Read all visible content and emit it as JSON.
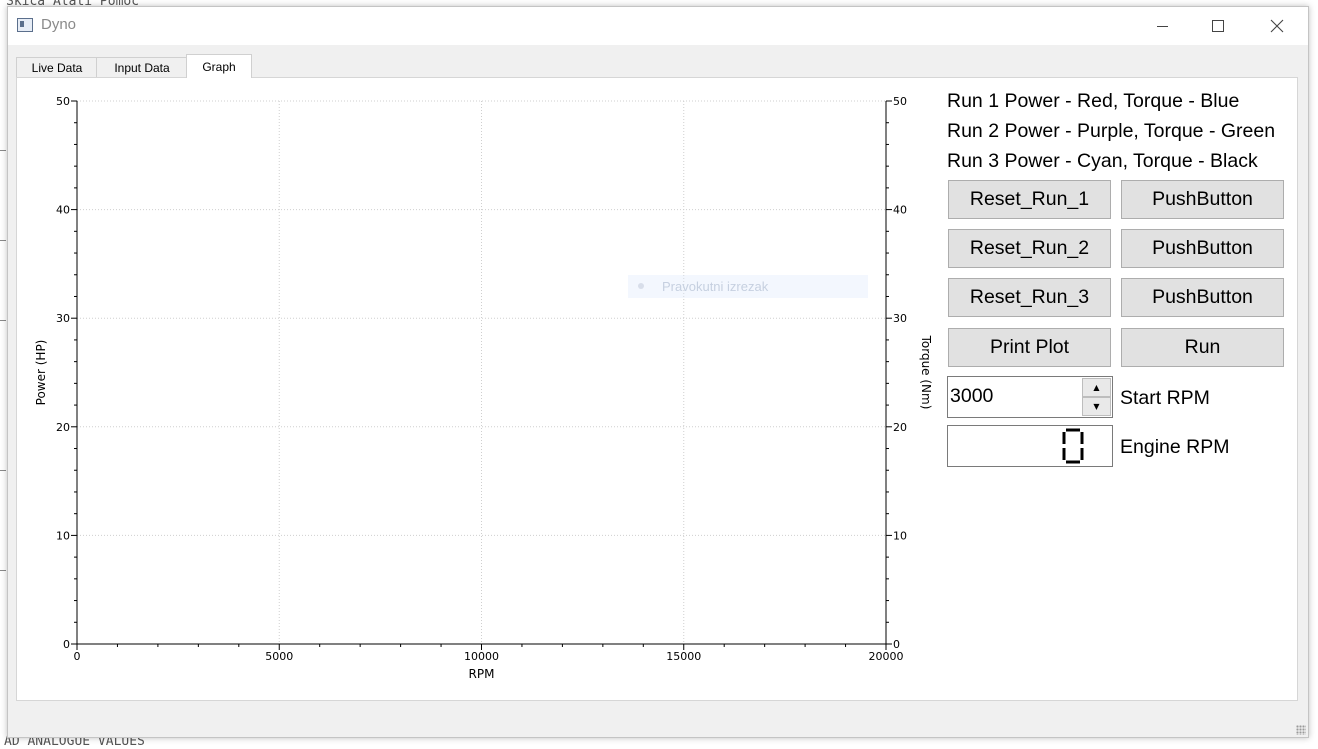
{
  "background": {
    "top_text": "Skica  Alati  Pomoć",
    "bottom_text": "AD ANALOGUE VALUES"
  },
  "window": {
    "title": "Dyno",
    "controls": [
      "minimize-icon",
      "maximize-icon",
      "close-icon"
    ],
    "tabs": [
      {
        "label": "Live Data",
        "active": false
      },
      {
        "label": "Input Data",
        "active": false
      },
      {
        "label": "Graph",
        "active": true
      }
    ]
  },
  "graph": {
    "tooltip": "Pravokutni izrezak"
  },
  "chart_data": {
    "type": "line",
    "title": "",
    "xlabel": "RPM",
    "ylabel": "Power (HP)",
    "y2label": "Torque (Nm)",
    "xlim": [
      0,
      20000
    ],
    "ylim": [
      0,
      50
    ],
    "y2lim": [
      0,
      50
    ],
    "x_ticks": [
      0,
      5000,
      10000,
      15000,
      20000
    ],
    "y_ticks": [
      0,
      10,
      20,
      30,
      40,
      50
    ],
    "y2_ticks": [
      0,
      10,
      20,
      30,
      40,
      50
    ],
    "grid": true,
    "series": []
  },
  "legend": {
    "run1": "Run 1 Power - Red, Torque - Blue",
    "run2": "Run 2 Power - Purple, Torque - Green",
    "run3": "Run 3 Power - Cyan, Torque - Black"
  },
  "buttons": {
    "reset1": "Reset_Run_1",
    "reset2": "Reset_Run_2",
    "reset3": "Reset_Run_3",
    "push1": "PushButton",
    "push2": "PushButton",
    "push3": "PushButton",
    "print": "Print Plot",
    "run": "Run"
  },
  "start_rpm": {
    "value": "3000",
    "label": "Start RPM"
  },
  "engine_rpm": {
    "value": "0",
    "label": "Engine RPM"
  },
  "colors": {
    "accent": "#e1e1e1",
    "grid": "#c8c8c8"
  }
}
